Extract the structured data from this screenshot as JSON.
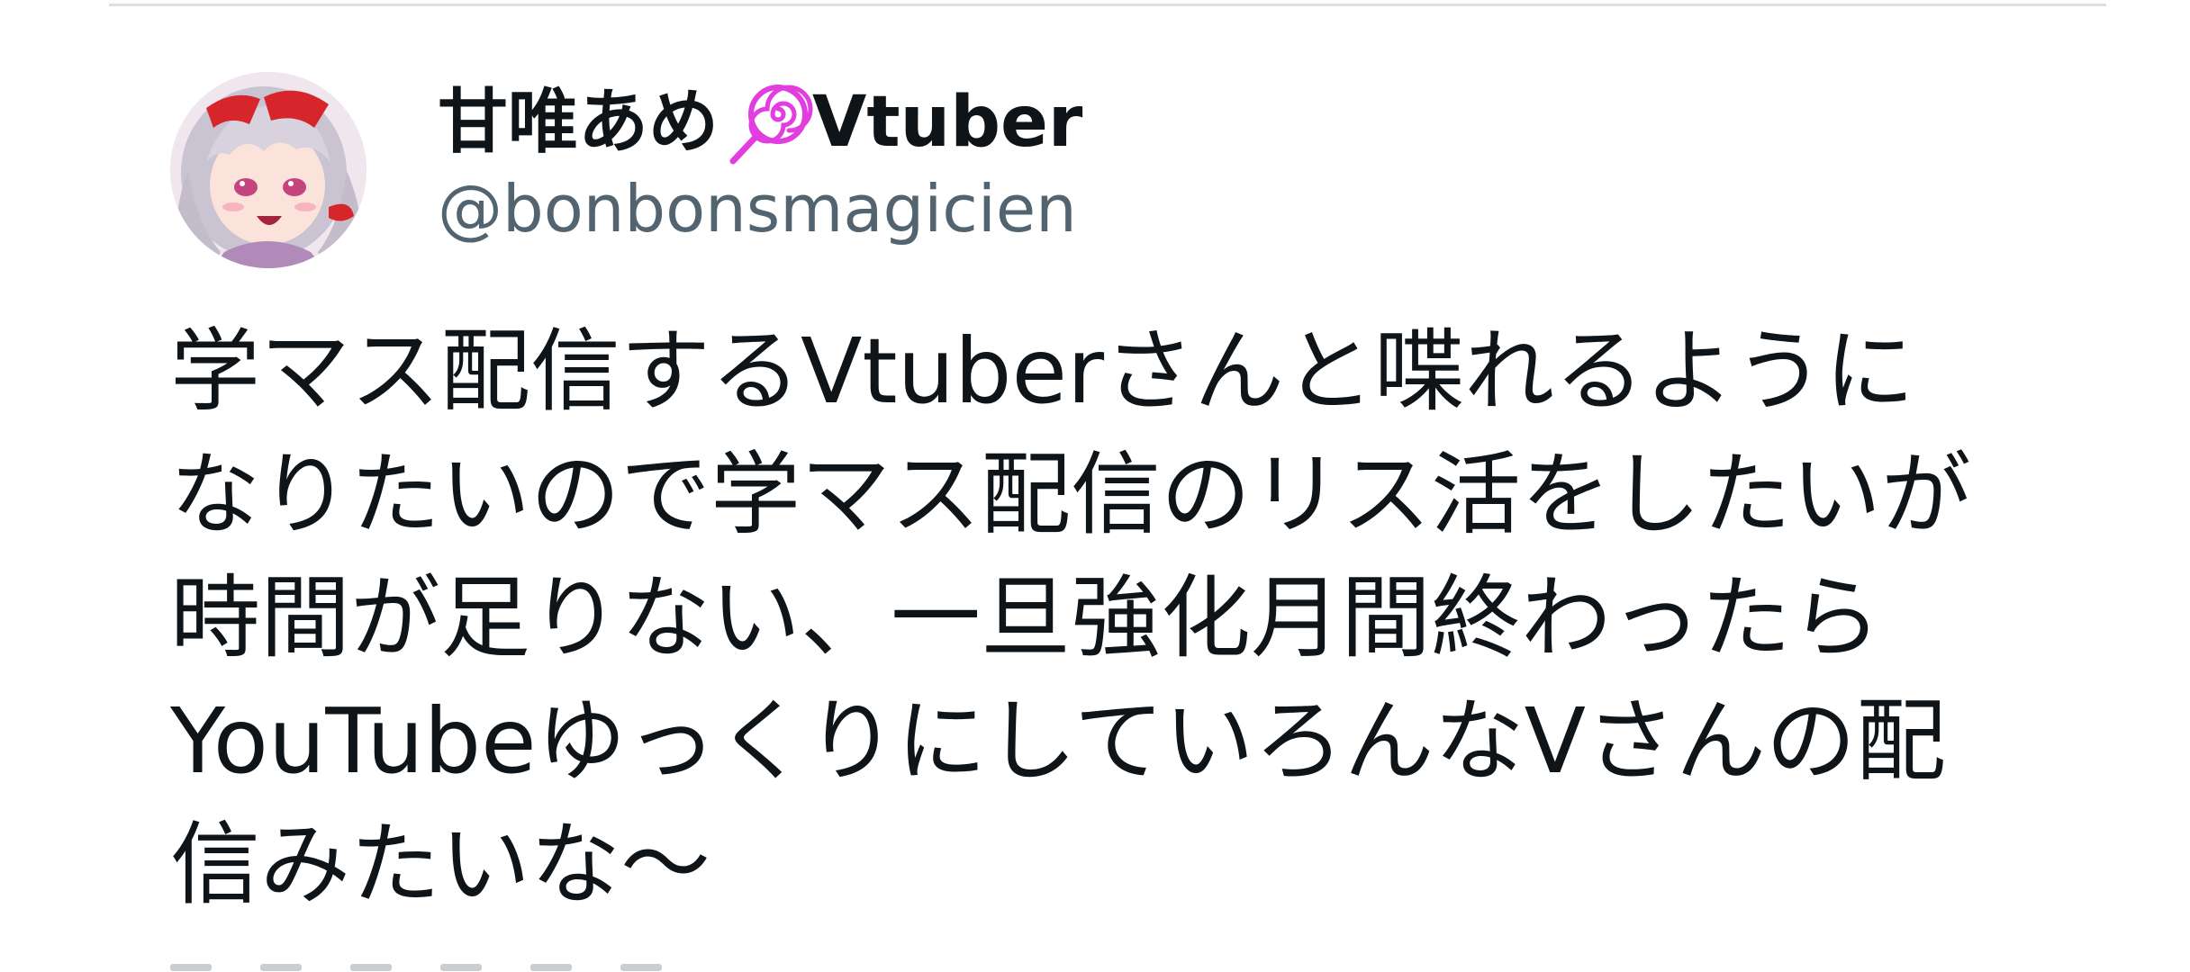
{
  "tweet": {
    "display_name": "甘唯あめ",
    "display_name_suffix": "Vtuber",
    "name_emoji": "lollipop-icon",
    "handle": "@bonbonsmagicien",
    "text_lines": [
      "学マス配信するVtuberさんと喋れるように",
      "なりたいので学マス配信のリス活をしたいが",
      "時間が足りない、一旦強化月間終わったら",
      "YouTubeゆっくりにしていろんなVさんの配",
      "信みたいな〜"
    ]
  },
  "colors": {
    "text": "#0f1419",
    "handle": "#536471",
    "divider": "#dcdfe2",
    "lollipop": "#e23ddf"
  }
}
